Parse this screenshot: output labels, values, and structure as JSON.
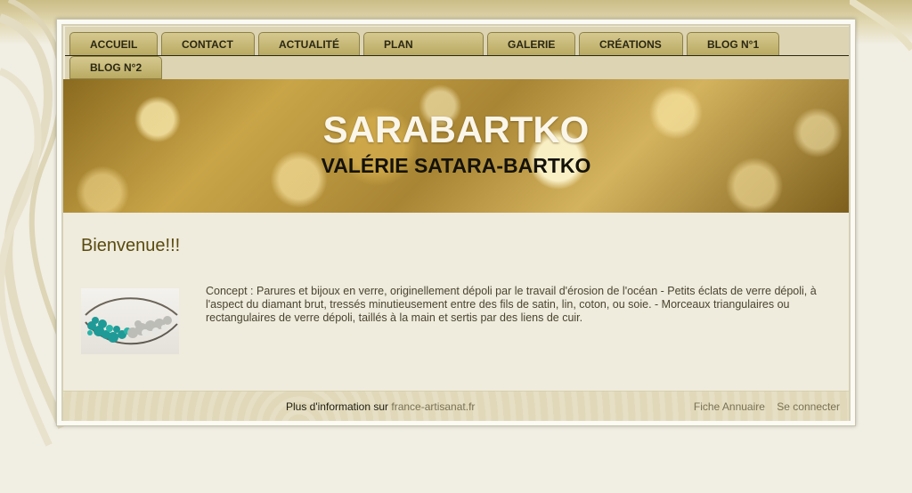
{
  "nav": {
    "tabs": [
      {
        "label": "ACCUEIL"
      },
      {
        "label": "CONTACT"
      },
      {
        "label": "ACTUALITÉ"
      },
      {
        "label": "PLAN"
      },
      {
        "label": "GALERIE"
      },
      {
        "label": "CRÉATIONS"
      },
      {
        "label": "BLOG N°1"
      },
      {
        "label": "BLOG N°2"
      }
    ]
  },
  "header": {
    "title": "SARABARTKO",
    "subtitle": "VALÉRIE SATARA-BARTKO"
  },
  "main": {
    "heading": "Bienvenue!!!",
    "image_alt": "turquoise glass bracelet",
    "description": "Concept : Parures et bijoux en verre, originellement dépoli par le travail d'érosion de l'océan - Petits éclats de verre dépoli, à l'aspect du diamant brut, tressés minutieusement entre des fils de satin, lin, coton, ou soie. - Morceaux triangulaires ou rectangulaires de verre dépoli, taillés à la main et sertis par des liens de cuir."
  },
  "footer": {
    "info_text": "Plus d'information sur",
    "info_link": "france-artisanat.fr",
    "directory_link": "Fiche Annuaire",
    "login_link": "Se connecter"
  },
  "colors": {
    "accent": "#b9aa62",
    "heading": "#5a4b0e",
    "background": "#f1eee3"
  }
}
